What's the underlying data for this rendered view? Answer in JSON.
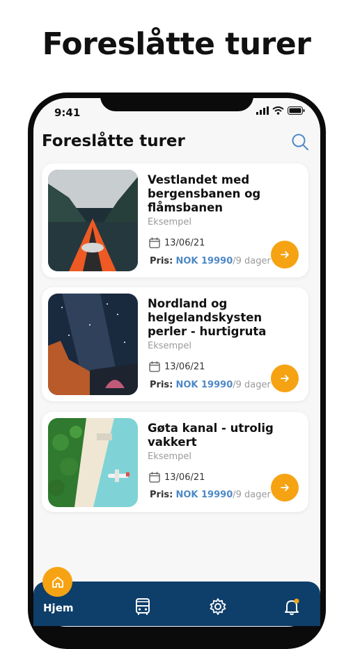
{
  "headline": "Foreslåtte turer",
  "status": {
    "time": "9:41"
  },
  "header": {
    "title": "Foreslåtte turer"
  },
  "trips": [
    {
      "title": "Vestlandet med bergensbanen og flåmsbanen",
      "subtitle": "Eksempel",
      "date": "13/06/21",
      "price_label": "Pris:",
      "price_value": "NOK 19990",
      "duration": "/9 dager",
      "image": "kayak-fjord-photo"
    },
    {
      "title": "Nordland og helgelandskysten perler - hurtigruta",
      "subtitle": "Eksempel",
      "date": "13/06/21",
      "price_label": "Pris:",
      "price_value": "NOK 19990",
      "duration": "/9 dager",
      "image": "milky-way-camp-photo"
    },
    {
      "title": "Gøta kanal - utrolig vakkert",
      "subtitle": "Eksempel",
      "date": "13/06/21",
      "price_label": "Pris:",
      "price_value": "NOK 19990",
      "duration": "/9 dager",
      "image": "tropical-island-seaplane-photo"
    }
  ],
  "tabbar": {
    "home_label": "Hjem",
    "icons": [
      "home-icon",
      "bus-icon",
      "gear-icon",
      "bell-icon"
    ]
  },
  "colors": {
    "accent": "#f6a313",
    "nav": "#0e3e6a",
    "price": "#4e89c7"
  }
}
